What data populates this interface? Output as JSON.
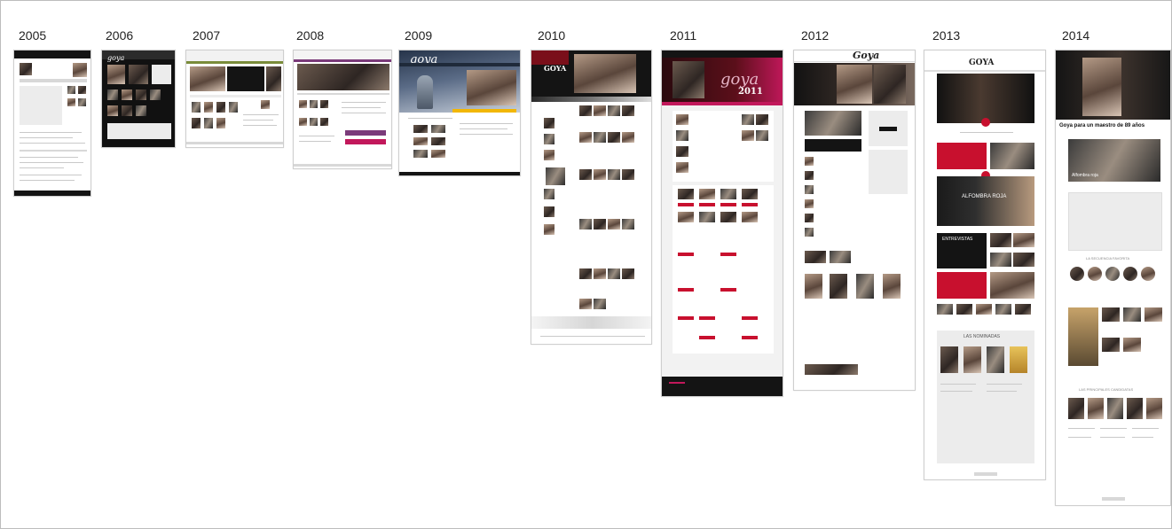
{
  "timeline": {
    "years": [
      {
        "label": "2005"
      },
      {
        "label": "2006"
      },
      {
        "label": "2007"
      },
      {
        "label": "2008"
      },
      {
        "label": "2009"
      },
      {
        "label": "2010"
      },
      {
        "label": "2011"
      },
      {
        "label": "2012"
      },
      {
        "label": "2013"
      },
      {
        "label": "2014"
      }
    ]
  },
  "thumbs": {
    "y2006_logo": "goya",
    "y2009_logo": "goya",
    "y2010_logo": "GOYA",
    "y2011_logo": "goya",
    "y2011_year": "2011",
    "y2012_logo": "Goya",
    "y2013_logo": "GOYA",
    "y2013_section1": "ALFOMBRA ROJA",
    "y2013_section2": "ENTREVISTAS",
    "y2013_section3": "LAS NOMINADAS",
    "y2014_headline": "Goya para un maestro de 89 años",
    "y2014_sub": "Alfombra roja",
    "y2014_section1": "LA SECUENCIA FAVORITA",
    "y2014_section2": "LAS PRINCIPALES CANDIDATAS"
  },
  "colors": {
    "accent_red": "#c8102e",
    "dark": "#141414",
    "frame_border": "#bdbdbd"
  }
}
